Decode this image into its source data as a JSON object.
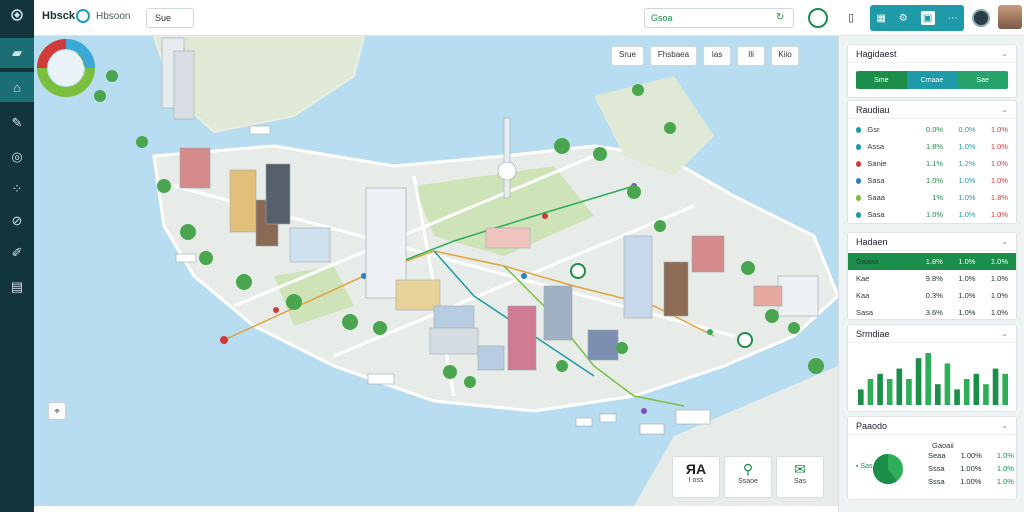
{
  "app": {
    "brand": "Hbsck",
    "subtitle": "Hbsoon",
    "top_select": "Sue"
  },
  "search": {
    "value": "Gsoa"
  },
  "sidebar": {
    "icons": [
      "stack-icon",
      "building-icon",
      "pen-icon",
      "target-icon",
      "grid-icon",
      "compass-icon",
      "pin-icon",
      "document-icon"
    ],
    "active_index": 1
  },
  "map_tools": [
    {
      "label": "Srue"
    },
    {
      "label": "Fhsbaea"
    },
    {
      "label": "Ias"
    },
    {
      "label": "Ili"
    },
    {
      "label": "Kiio"
    }
  ],
  "bottom_cards": [
    {
      "big": "ЯA",
      "label": "I oss"
    },
    {
      "big": "⚲",
      "label": "Ssaoe"
    },
    {
      "big": "✉",
      "label": "Sas"
    }
  ],
  "panel": {
    "layers": {
      "title": "Hagidaest",
      "segments": [
        "Sme",
        "Cmaae",
        "Sae"
      ],
      "segment_colors": [
        "#1b8e4a",
        "#1f9aa8",
        "#25a36a"
      ]
    },
    "routes": {
      "title": "Raudiau",
      "rows": [
        {
          "name": "Gsr",
          "color": "#1f9aa8",
          "a": "0.0%",
          "b": "0.0%",
          "c": "1.0%"
        },
        {
          "name": "Assa",
          "color": "#1f9aa8",
          "a": "1.8%",
          "b": "1.0%",
          "c": "1.0%"
        },
        {
          "name": "Sanie",
          "color": "#d03a3a",
          "a": "1.1%",
          "b": "1.2%",
          "c": "1.0%"
        },
        {
          "name": "Sasa",
          "color": "#2f7fbf",
          "a": "1.0%",
          "b": "1.0%",
          "c": "1.0%"
        },
        {
          "name": "Saaa",
          "color": "#7bbf3f",
          "a": "1%",
          "b": "1.0%",
          "c": "1.8%"
        },
        {
          "name": "Sasa",
          "color": "#1f9aa8",
          "a": "1.0%",
          "b": "1.0%",
          "c": "1.0%"
        }
      ]
    },
    "stats": {
      "title": "Hadaen",
      "rows": [
        {
          "name": "Gaaaa",
          "a": "1.8%",
          "b": "1.0%",
          "c": "1.0%",
          "hl": true
        },
        {
          "name": "Kae",
          "a": "9.8%",
          "b": "1.0%",
          "c": "1.0%",
          "hl": false
        },
        {
          "name": "Kaa",
          "a": "0.3%",
          "b": "1.0%",
          "c": "1.0%",
          "hl": false
        },
        {
          "name": "Sasa",
          "a": "3.6%",
          "b": "1.0%",
          "c": "1.0%",
          "hl": false
        }
      ]
    },
    "chart": {
      "title": "Srmdiae",
      "values": [
        0.3,
        0.5,
        0.6,
        0.5,
        0.7,
        0.5,
        0.9,
        1.0,
        0.4,
        0.8,
        0.3,
        0.5,
        0.6,
        0.4,
        0.7,
        0.6
      ],
      "colors": [
        "#1b8e4a",
        "#2fae5a"
      ]
    },
    "kpi": {
      "title": "Paaodo",
      "header": "Gaoaii",
      "rows": [
        {
          "name": "Seaa",
          "a": "1.00%",
          "b": "1.0%"
        },
        {
          "name": "Sssa",
          "a": "1.00%",
          "b": "1.0%"
        },
        {
          "name": "Sssa",
          "a": "1.00%",
          "b": "1.0%"
        }
      ],
      "donut_share": 0.6
    }
  },
  "colors": {
    "accent": "#1b8e4a",
    "teal": "#1f9aa8",
    "sidebar": "#12343b",
    "water": "#b9ddf0"
  }
}
